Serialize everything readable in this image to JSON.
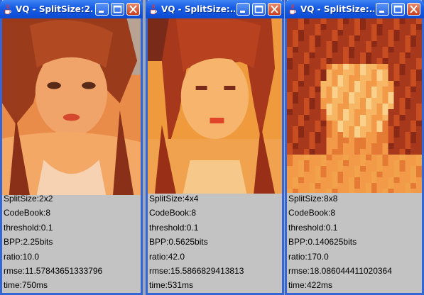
{
  "windows": [
    {
      "title": "VQ - SplitSize:2...",
      "lines": [
        "SplitSize:2x2",
        "CodeBook:8",
        "threshold:0.1",
        "BPP:2.25bits",
        "ratio:10.0",
        "rmse:11.57843651333796",
        "time:750ms"
      ]
    },
    {
      "title": "VQ - SplitSize:...",
      "lines": [
        "SplitSize:4x4",
        "CodeBook:8",
        "threshold:0.1",
        "BPP:0.5625bits",
        "ratio:42.0",
        "rmse:15.5866829413813",
        "time:531ms"
      ]
    },
    {
      "title": "VQ - SplitSize:...",
      "lines": [
        "SplitSize:8x8",
        "CodeBook:8",
        "threshold:0.1",
        "BPP:0.140625bits",
        "ratio:170.0",
        "rmse:18.086044411020364",
        "time:422ms"
      ]
    }
  ],
  "colors": {
    "titlebar": "#0a4bd2",
    "frame": "#3466d6",
    "panel": "#c3c3c3",
    "desktop": "#9ea7b6"
  },
  "icons": [
    "java-cup-icon",
    "minimize-icon",
    "maximize-icon",
    "close-icon"
  ]
}
